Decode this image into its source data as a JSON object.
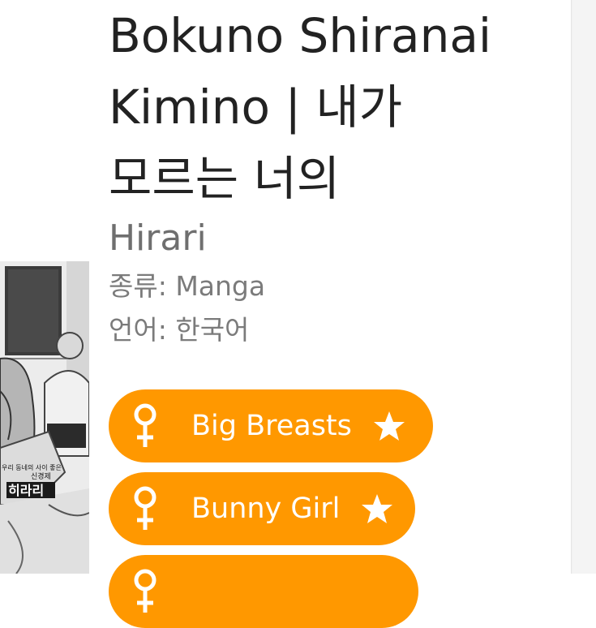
{
  "title": "Bokuno Shiranai\nKimino | 내가\n모르는 너의",
  "artist": "Hirari",
  "category": "종류: Manga",
  "language": "언어: 한국어",
  "cover": {
    "caption_small": "우리 동네의 사이 좋은",
    "caption_mid": "신경제",
    "caption_name": "히라리"
  },
  "tags": [
    {
      "label": "Big Breasts",
      "icon": "female-icon",
      "fav": "star-icon"
    },
    {
      "label": "Bunny Girl",
      "icon": "female-icon",
      "fav": "star-icon"
    },
    {
      "label": "",
      "icon": "female-icon",
      "fav": "star-icon"
    }
  ],
  "colors": {
    "tag_bg": "#ff9800",
    "title": "#222222",
    "subtle": "#7b7b7b"
  }
}
